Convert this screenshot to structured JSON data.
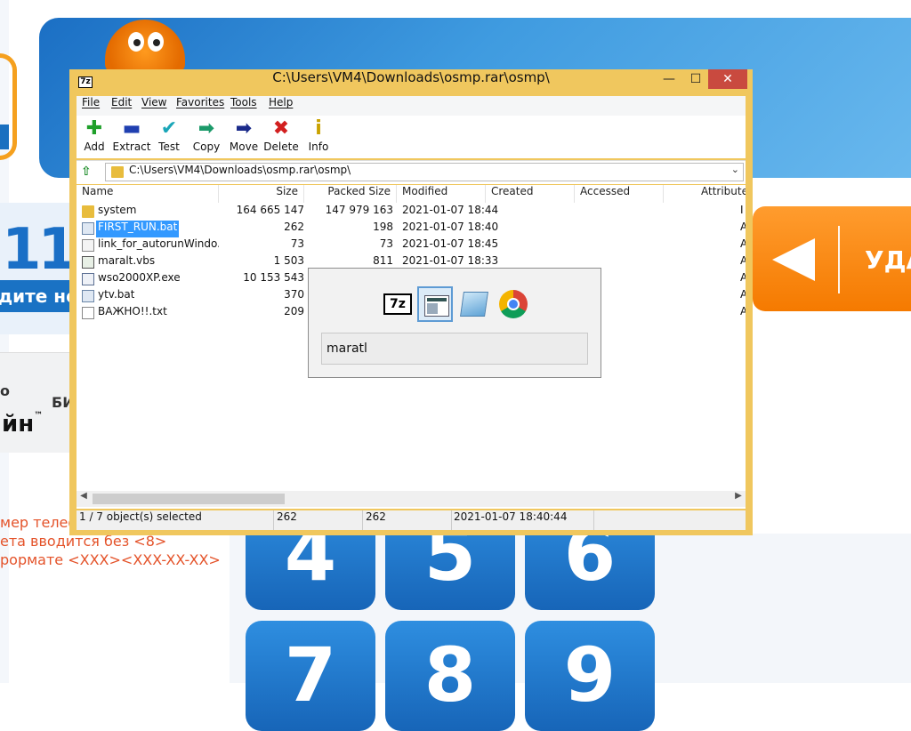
{
  "background_app": {
    "phone_number_digits": "11",
    "enter_prompt": "дите но",
    "operator_name": "йн",
    "operator_tm": "™",
    "operator_mark": "о",
    "operator_prefix": "БИ",
    "hint_lines": [
      "мер телеф",
      "ета вводится без <8>",
      "рормате <XXX><XXX-XX-XX>"
    ],
    "delete_label": "УДА",
    "keypad": [
      "4",
      "5",
      "6",
      "7",
      "8",
      "9"
    ]
  },
  "window": {
    "title": "C:\\Users\\VM4\\Downloads\\osmp.rar\\osmp\\",
    "app_icon_text": "7z",
    "controls": {
      "minimize": "—",
      "maximize": "☐",
      "close": "✕"
    }
  },
  "menu": [
    {
      "label": "File"
    },
    {
      "label": "Edit"
    },
    {
      "label": "View"
    },
    {
      "label": "Favorites"
    },
    {
      "label": "Tools"
    },
    {
      "label": "Help"
    }
  ],
  "toolbar": [
    {
      "label": "Add",
      "icon": "add-icon",
      "glyph": "✚",
      "color": "#1fa02a"
    },
    {
      "label": "Extract",
      "icon": "extract-icon",
      "glyph": "▬",
      "color": "#1f3fb0"
    },
    {
      "label": "Test",
      "icon": "test-icon",
      "glyph": "✔",
      "color": "#1aa6b8"
    },
    {
      "label": "Copy",
      "icon": "copy-icon",
      "glyph": "➡",
      "color": "#1c9a6a"
    },
    {
      "label": "Move",
      "icon": "move-icon",
      "glyph": "➡",
      "color": "#1a2a8a"
    },
    {
      "label": "Delete",
      "icon": "delete-icon",
      "glyph": "✖",
      "color": "#d21f1f"
    },
    {
      "label": "Info",
      "icon": "info-icon",
      "glyph": "i",
      "color": "#c9a200"
    }
  ],
  "address": {
    "path": "C:\\Users\\VM4\\Downloads\\osmp.rar\\osmp\\"
  },
  "columns": [
    "Name",
    "Size",
    "Packed Size",
    "Modified",
    "Created",
    "Accessed",
    "Attribute"
  ],
  "files": [
    {
      "name": "system",
      "size": "164 665 147",
      "packed": "147 979 163",
      "modified": "2021-01-07 18:44",
      "type": "folder",
      "attr": "I"
    },
    {
      "name": "FIRST_RUN.bat",
      "size": "262",
      "packed": "198",
      "modified": "2021-01-07 18:40",
      "type": "bat",
      "attr": "A",
      "selected": true
    },
    {
      "name": "link_for_autorunWindo...",
      "size": "73",
      "packed": "73",
      "modified": "2021-01-07 18:45",
      "type": "lnk",
      "attr": "A"
    },
    {
      "name": "maralt.vbs",
      "size": "1 503",
      "packed": "811",
      "modified": "2021-01-07 18:33",
      "type": "vbs",
      "attr": "A"
    },
    {
      "name": "wso2000XP.exe",
      "size": "10 153 543",
      "packed": "",
      "modified": "",
      "type": "exe",
      "attr": "A"
    },
    {
      "name": "ytv.bat",
      "size": "370",
      "packed": "",
      "modified": "",
      "type": "bat",
      "attr": "A"
    },
    {
      "name": "ВАЖНО!!.txt",
      "size": "209",
      "packed": "",
      "modified": "",
      "type": "txt",
      "attr": "A"
    }
  ],
  "status": {
    "selection": "1 / 7 object(s) selected",
    "size": "262",
    "packed": "262",
    "modified": "2021-01-07 18:40:44"
  },
  "switcher": {
    "items": [
      {
        "name": "7zip-icon",
        "glyph": "7z"
      },
      {
        "name": "window-icon",
        "selected": true
      },
      {
        "name": "notepad-icon"
      },
      {
        "name": "chrome-icon"
      }
    ],
    "current_title": "maratl"
  }
}
